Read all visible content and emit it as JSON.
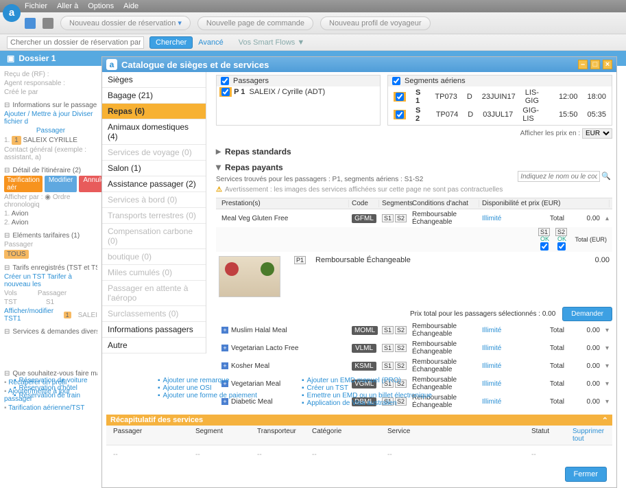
{
  "menu": {
    "file": "Fichier",
    "goto": "Aller à",
    "options": "Options",
    "help": "Aide"
  },
  "toolbar": {
    "new_booking": "Nouveau dossier de réservation",
    "new_cmd": "Nouvelle page de commande",
    "new_profile": "Nouveau profil de voyageur"
  },
  "searchbar": {
    "placeholder": "Chercher un dossier de réservation par nom ou référen",
    "search": "Chercher",
    "advanced": "Avancé",
    "smart": "Vos Smart Flows ▼"
  },
  "dossier": {
    "title": "Dossier 1"
  },
  "left": {
    "recu": "Reçu de (RF) :",
    "agent": "Agent responsable :",
    "cree": "Créé le par",
    "info_title": "Informations sur le passager et le c",
    "ajout": "Ajouter / Mettre à jour",
    "divide": "Diviser fichier d",
    "passager": "Passager",
    "pax1": "SALEIX CYRILLE",
    "pax_idx": "1.",
    "contact": "Contact général (exemple : assistant, a)",
    "itin_title": "Détail de l'itinéraire (2)",
    "tarif": "Tarification aér",
    "mod": "Modifier",
    "annul": "Annuler",
    "afficher": "Afficher par :",
    "ordre": "Ordre chronologiq",
    "r1_idx": "1.",
    "r1": "Avion",
    "r2_idx": "2.",
    "r2": "Avion",
    "elem_title": "Eléments tarifaires (1)",
    "pass_lbl": "Passager",
    "tous": "TOUS",
    "tst_title": "Tarifs enregistrés (TST et TSM)",
    "creer_tst": "Créer un TST",
    "retarif": "Tarifer à nouveau les",
    "vols": "Vols",
    "tst": "TST",
    "passenger": "Passager",
    "aff_tst": "Afficher/modifier TST1",
    "salei": "SALEI",
    "seg_col": "S1",
    "services": "Services & demandes diverses",
    "que": "Que souhaitez-vous faire maintena",
    "recup": "Récupérer un profil",
    "ajp": "Ajouter/mettre à jour passager",
    "tarif_air": "Tarification aérienne/TST"
  },
  "sidebar": {
    "items": [
      {
        "label": "Sièges",
        "bold": true
      },
      {
        "label": "Bagage (21)",
        "bold": true
      },
      {
        "label": "Repas (6)",
        "selected": true
      },
      {
        "label": "Animaux domestiques (4)",
        "bold": true
      },
      {
        "label": "Services de voyage (0)",
        "dim": true
      },
      {
        "label": "Salon (1)",
        "bold": true
      },
      {
        "label": "Assistance passager (2)",
        "bold": true
      },
      {
        "label": "Services à bord (0)",
        "dim": true
      },
      {
        "label": "Transports terrestres (0)",
        "dim": true
      },
      {
        "label": "Compensation carbone (0)",
        "dim": true
      },
      {
        "label": "boutique (0)",
        "dim": true
      },
      {
        "label": "Miles cumulés (0)",
        "dim": true
      },
      {
        "label": "Passager en attente à l'aéropo",
        "dim": true
      },
      {
        "label": "Surclassements (0)",
        "dim": true
      },
      {
        "label": "Informations passagers",
        "bold": true
      },
      {
        "label": "Autre",
        "bold": true
      }
    ]
  },
  "modal": {
    "title": "Catalogue de sièges et de services",
    "passagers": "Passagers",
    "segments": "Segments aériens",
    "pax_p1": "P 1",
    "pax_name": "SALEIX / Cyrille (ADT)",
    "seg": [
      {
        "s": "S 1",
        "fl": "TP073",
        "cls": "D",
        "date": "23JUIN17",
        "route": "LIS-GIG",
        "dep": "12:00",
        "arr": "18:00"
      },
      {
        "s": "S 2",
        "fl": "TP074",
        "cls": "D",
        "date": "03JUL17",
        "route": "GIG-LIS",
        "dep": "15:50",
        "arr": "05:35"
      }
    ],
    "afficher_prix": "Afficher les prix en :",
    "currency": "EUR",
    "standards": "Repas standards",
    "payants": "Repas payants",
    "found": "Services trouvés pour les passagers : P1, segments aériens : S1-S2",
    "warn": "Avertissement : les images des services affichées sur cette page ne sont pas contractuelles",
    "filter_ph": "Indiquez le nom ou le code du service",
    "th": {
      "prest": "Prestation(s)",
      "code": "Code",
      "seg": "Segments",
      "cond": "Conditions d'achat",
      "disp": "Disponibilité et prix (EUR)",
      "total": "Total",
      "price": "0.00"
    },
    "th2": {
      "s1": "S1",
      "s2": "S2",
      "ok": "OK",
      "total": "Total",
      "cur": "(EUR)"
    },
    "open_meal": {
      "name": "Meal Veg Gluten Free",
      "code": "GFML",
      "seg": [
        "S1",
        "S2"
      ],
      "cond": "Remboursable  Échangeable",
      "disp": "Illimité",
      "total": "Total",
      "price": "0.00"
    },
    "detail": {
      "p1": "P1",
      "cond": "Remboursable  Échangeable",
      "price": "0.00"
    },
    "totalline": "Prix total pour les passagers sélectionnés : 0.00",
    "demander": "Demander",
    "list": [
      {
        "name": "Muslim Halal Meal",
        "code": "MOML",
        "cond": "Remboursable  Échangeable",
        "disp": "Illimité",
        "price": "0.00"
      },
      {
        "name": "Vegetarian Lacto Free",
        "code": "VLML",
        "cond": "Remboursable  Échangeable",
        "disp": "Illimité",
        "price": "0.00"
      },
      {
        "name": "Kosher Meal",
        "code": "KSML",
        "cond": "Remboursable  Échangeable",
        "disp": "Illimité",
        "price": "0.00"
      },
      {
        "name": "Vegetarian Meal",
        "code": "VGML",
        "cond": "Remboursable  Échangeable",
        "disp": "Illimité",
        "price": "0.00"
      },
      {
        "name": "Diabetic Meal",
        "code": "DBML",
        "cond": "Remboursable  Échangeable",
        "disp": "Illimité",
        "price": "0.00"
      }
    ],
    "recap": "Récapitulatif des services",
    "rh": {
      "pass": "Passager",
      "seg": "Segment",
      "tr": "Transporteur",
      "cat": "Catégorie",
      "svc": "Service",
      "stat": "Statut",
      "del": "Supprimer tout"
    },
    "dash": "--",
    "fermer": "Fermer"
  },
  "bottom": {
    "c1": [
      "Réservation de voiture",
      "Réservation d'hôtel",
      "Réservation de train"
    ],
    "c2": [
      "Ajouter une remarque",
      "Ajouter une OSI",
      "Ajouter une forme de paiement"
    ],
    "c3": [
      "Ajouter un EMD manuel (PRO)",
      "Créer un TST",
      "Emettre un EMD ou un billet électronique",
      "Application de Visa australien"
    ]
  }
}
